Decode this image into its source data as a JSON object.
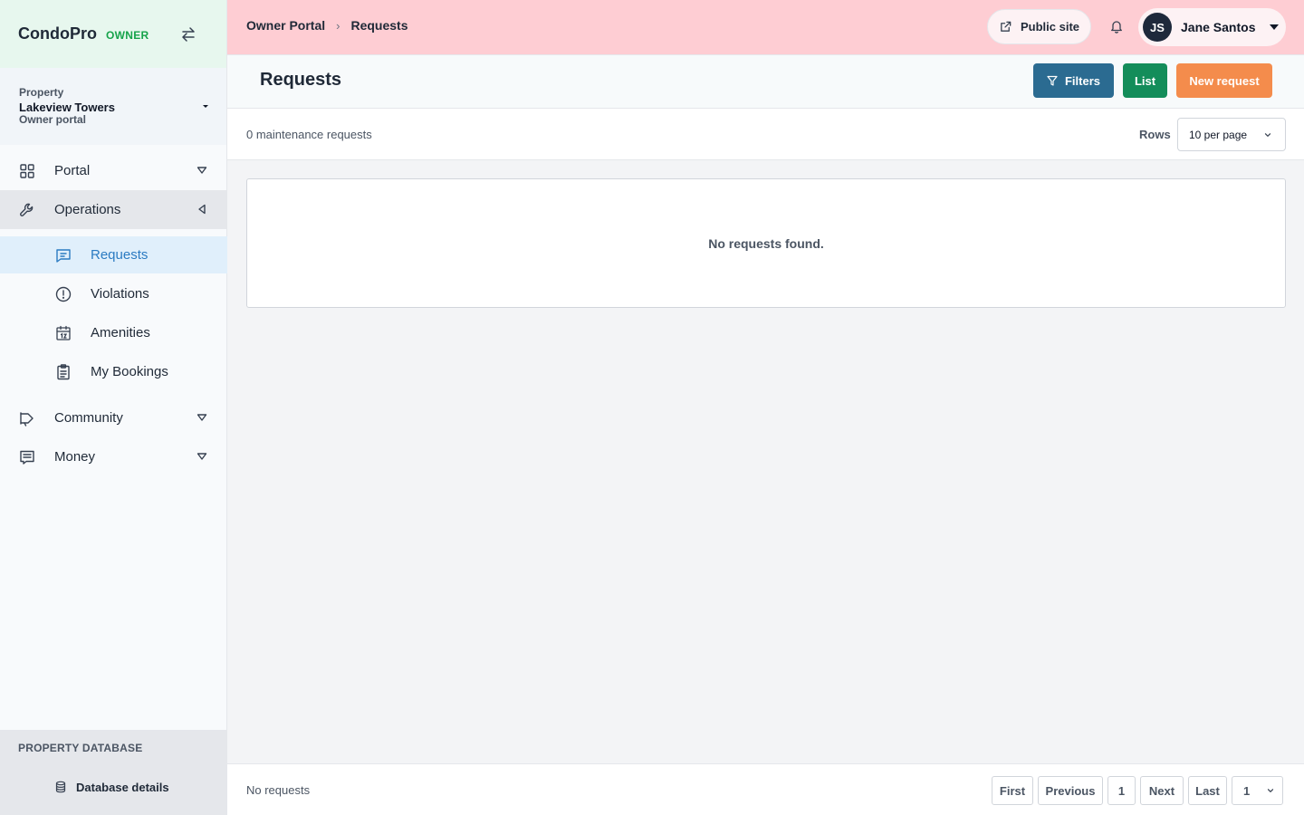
{
  "brand": {
    "name": "CondoPro",
    "role": "OWNER"
  },
  "property": {
    "label": "Property",
    "name": "Lakeview Towers",
    "sub": "Owner portal"
  },
  "nav": {
    "portal": "Portal",
    "operations": "Operations",
    "requests": "Requests",
    "violations": "Violations",
    "amenities": "Amenities",
    "bookings": "My Bookings",
    "community": "Community",
    "money": "Money"
  },
  "database": {
    "title": "PROPERTY DATABASE",
    "link": "Database details"
  },
  "topbar": {
    "crumb_root": "Owner Portal",
    "crumb_sep": "›",
    "crumb_current": "Requests",
    "public_site": "Public site",
    "user_initials": "JS",
    "user_name": "Jane Santos"
  },
  "header": {
    "title": "Requests",
    "filters": "Filters",
    "list": "List",
    "new_request": "New request"
  },
  "summary": {
    "count_text": "0 maintenance requests",
    "rows_label": "Rows",
    "rows_value": "10 per page"
  },
  "empty": {
    "message": "No requests found."
  },
  "footer": {
    "status": "No requests",
    "first": "First",
    "previous": "Previous",
    "page": "1",
    "next": "Next",
    "last": "Last",
    "page_select": "1"
  },
  "colors": {
    "topbar_bg": "#fecdd3",
    "brand_bg": "#e7f7ee",
    "brand_role": "#16a34a",
    "filters_btn": "#2b6b91",
    "list_btn": "#138d5a",
    "new_btn": "#f48c4c",
    "active_nav_text": "#2b7bc2"
  },
  "icons": {
    "switch": "swap-arrows-icon",
    "portal": "grid-icon",
    "operations": "wrench-icon",
    "requests": "message-square-icon",
    "violations": "alert-circle-icon",
    "amenities": "calendar-icon",
    "bookings": "clipboard-icon",
    "community": "megaphone-icon",
    "money": "receipt-icon",
    "database": "database-icon",
    "public_site": "external-link-icon",
    "bell": "bell-icon",
    "filter": "filter-icon"
  }
}
